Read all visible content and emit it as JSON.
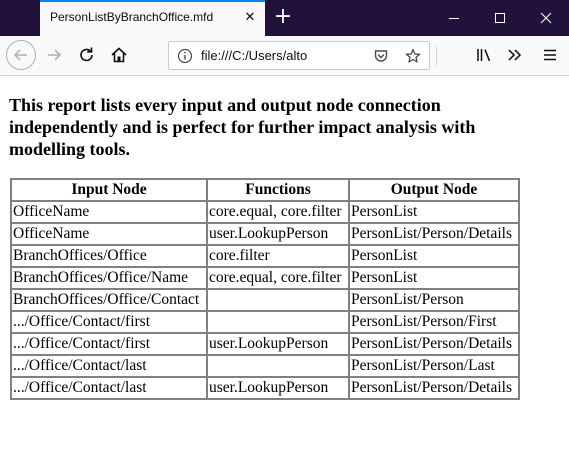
{
  "browser": {
    "tab_title": "PersonListByBranchOffice.mfd",
    "address_url": "file:///C:/Users/alto",
    "icons": {
      "close_tab": "close-icon",
      "new_tab": "plus-icon",
      "minimize": "minimize-icon",
      "maximize": "maximize-icon",
      "close_window": "close-window-icon",
      "back": "arrow-left-icon",
      "forward": "arrow-right-icon",
      "reload": "reload-icon",
      "home": "home-icon",
      "info": "info-icon",
      "pocket": "pocket-icon",
      "bookmark": "star-icon",
      "library": "library-icon",
      "overflow": "chevron-double-right-icon",
      "menu": "hamburger-menu-icon"
    },
    "colors": {
      "titlebar": "#20123a",
      "tab_accent": "#0a84ff"
    }
  },
  "report": {
    "heading": "This report lists every input and output node connection independently and is perfect for further impact analysis with modelling tools.",
    "columns": [
      "Input Node",
      "Functions",
      "Output Node"
    ],
    "rows": [
      [
        "OfficeName",
        "core.equal, core.filter",
        "PersonList"
      ],
      [
        "OfficeName",
        "user.LookupPerson",
        "PersonList/Person/Details"
      ],
      [
        "BranchOffices/Office",
        "core.filter",
        "PersonList"
      ],
      [
        "BranchOffices/Office/Name",
        "core.equal, core.filter",
        "PersonList"
      ],
      [
        "BranchOffices/Office/Contact",
        "",
        "PersonList/Person"
      ],
      [
        ".../Office/Contact/first",
        "",
        "PersonList/Person/First"
      ],
      [
        ".../Office/Contact/first",
        "user.LookupPerson",
        "PersonList/Person/Details"
      ],
      [
        ".../Office/Contact/last",
        "",
        "PersonList/Person/Last"
      ],
      [
        ".../Office/Contact/last",
        "user.LookupPerson",
        "PersonList/Person/Details"
      ]
    ]
  }
}
